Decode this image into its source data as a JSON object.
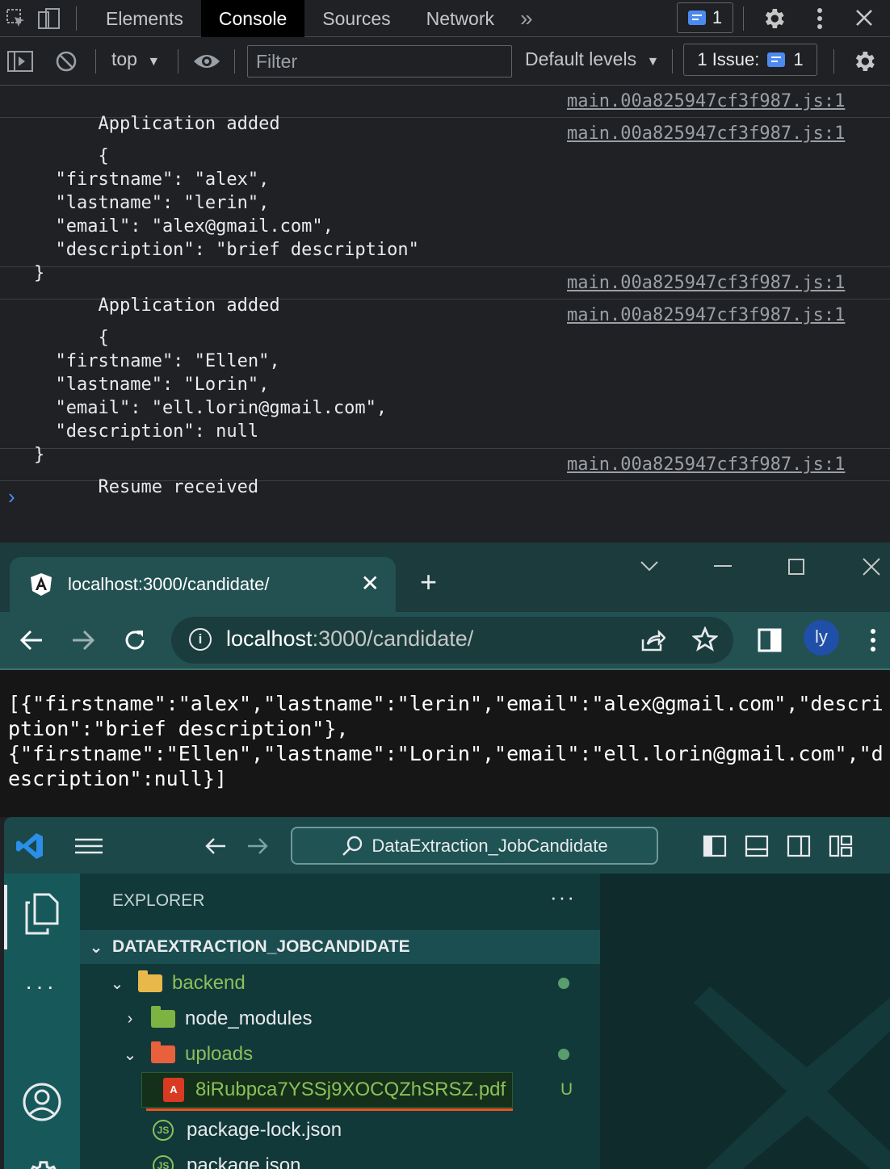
{
  "devtools": {
    "tabs": [
      "Elements",
      "Console",
      "Sources",
      "Network"
    ],
    "more_tabs": "»",
    "issue_count_badge": "1",
    "toolbar": {
      "context": "top",
      "filter_placeholder": "Filter",
      "levels": "Default levels",
      "issues_label": "1 Issue:",
      "issues_count": "1"
    },
    "logs": [
      {
        "text": "Application added",
        "source": "main.00a825947cf3f987.js:1"
      },
      {
        "text": "{\n  \"firstname\": \"alex\",\n  \"lastname\": \"lerin\",\n  \"email\": \"alex@gmail.com\",\n  \"description\": \"brief description\"\n}",
        "source": "main.00a825947cf3f987.js:1"
      },
      {
        "text": "Application added",
        "source": "main.00a825947cf3f987.js:1"
      },
      {
        "text": "{\n  \"firstname\": \"Ellen\",\n  \"lastname\": \"Lorin\",\n  \"email\": \"ell.lorin@gmail.com\",\n  \"description\": null\n}",
        "source": "main.00a825947cf3f987.js:1"
      },
      {
        "text": "Resume received",
        "source": "main.00a825947cf3f987.js:1"
      }
    ],
    "prompt": "›"
  },
  "browser": {
    "tab_title": "localhost:3000/candidate/",
    "url_host": "localhost",
    "url_path": ":3000/candidate/",
    "profile_initials": "ly"
  },
  "page": {
    "body": "[{\"firstname\":\"alex\",\"lastname\":\"lerin\",\"email\":\"alex@gmail.com\",\"description\":\"brief description\"},\n{\"firstname\":\"Ellen\",\"lastname\":\"Lorin\",\"email\":\"ell.lorin@gmail.com\",\"description\":null}]"
  },
  "vscode": {
    "search": "DataExtraction_JobCandidate",
    "explorer_title": "EXPLORER",
    "explorer_more": "···",
    "activity_more": "···",
    "project": "DATAEXTRACTION_JOBCANDIDATE",
    "tree": {
      "backend": "backend",
      "node_modules": "node_modules",
      "uploads": "uploads",
      "pdf": "8iRubpca7YSSj9XOCQZhSRSZ.pdf",
      "pdf_status": "U",
      "package_lock": "package-lock.json",
      "package": "package.json"
    },
    "colors": {
      "untracked": "#8dbf5a",
      "highlight_underline": "#e8561f"
    }
  }
}
